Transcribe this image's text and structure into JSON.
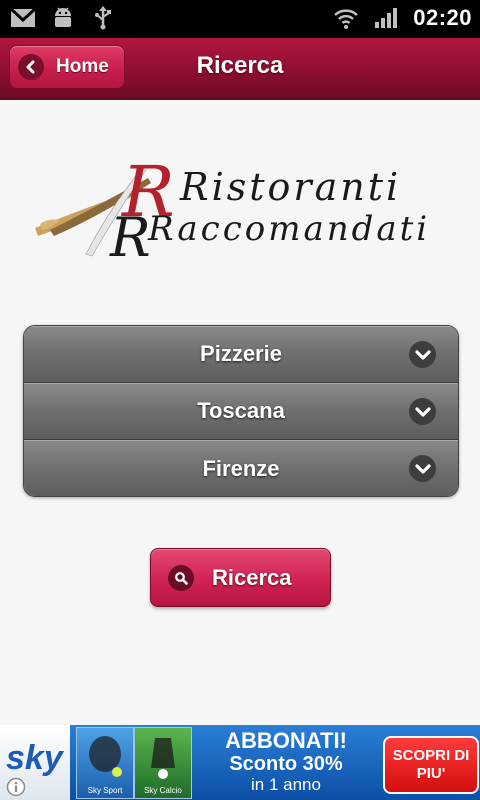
{
  "status_bar": {
    "time": "02:20",
    "icons": [
      "gmail-icon",
      "android-debug-icon",
      "usb-icon",
      "wifi-icon",
      "signal-icon"
    ]
  },
  "header": {
    "home_label": "Home",
    "title": "Ricerca"
  },
  "logo": {
    "line1": "Ristoranti",
    "line2": "Raccomandati"
  },
  "filters": [
    {
      "label": "Pizzerie"
    },
    {
      "label": "Toscana"
    },
    {
      "label": "Firenze"
    }
  ],
  "search_button": {
    "label": "Ricerca"
  },
  "ad": {
    "brand": "sky",
    "thumb1_caption": "Sky Sport",
    "thumb2_caption": "Sky Calcio",
    "headline": "ABBONATI!",
    "discount": "Sconto 30%",
    "duration": "in 1 anno",
    "cta": "SCOPRI DI PIU'"
  },
  "colors": {
    "header_bg": "#8d0f30",
    "accent_button": "#d32556",
    "select_bg": "#6f6f6f",
    "ad_bg": "#0c4fa7"
  }
}
